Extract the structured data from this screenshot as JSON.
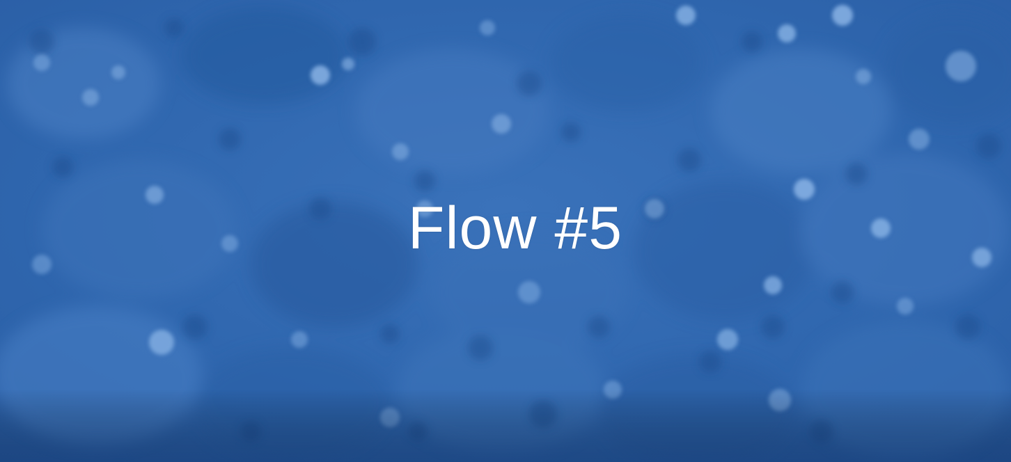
{
  "caption": {
    "text": "Flow #5"
  },
  "colors": {
    "background_base": "#2f65ad",
    "background_light": "#5b8fd0",
    "background_dark": "#1f4f92",
    "particle_light": "#9cc2ec",
    "caption_text": "#ffffff"
  }
}
